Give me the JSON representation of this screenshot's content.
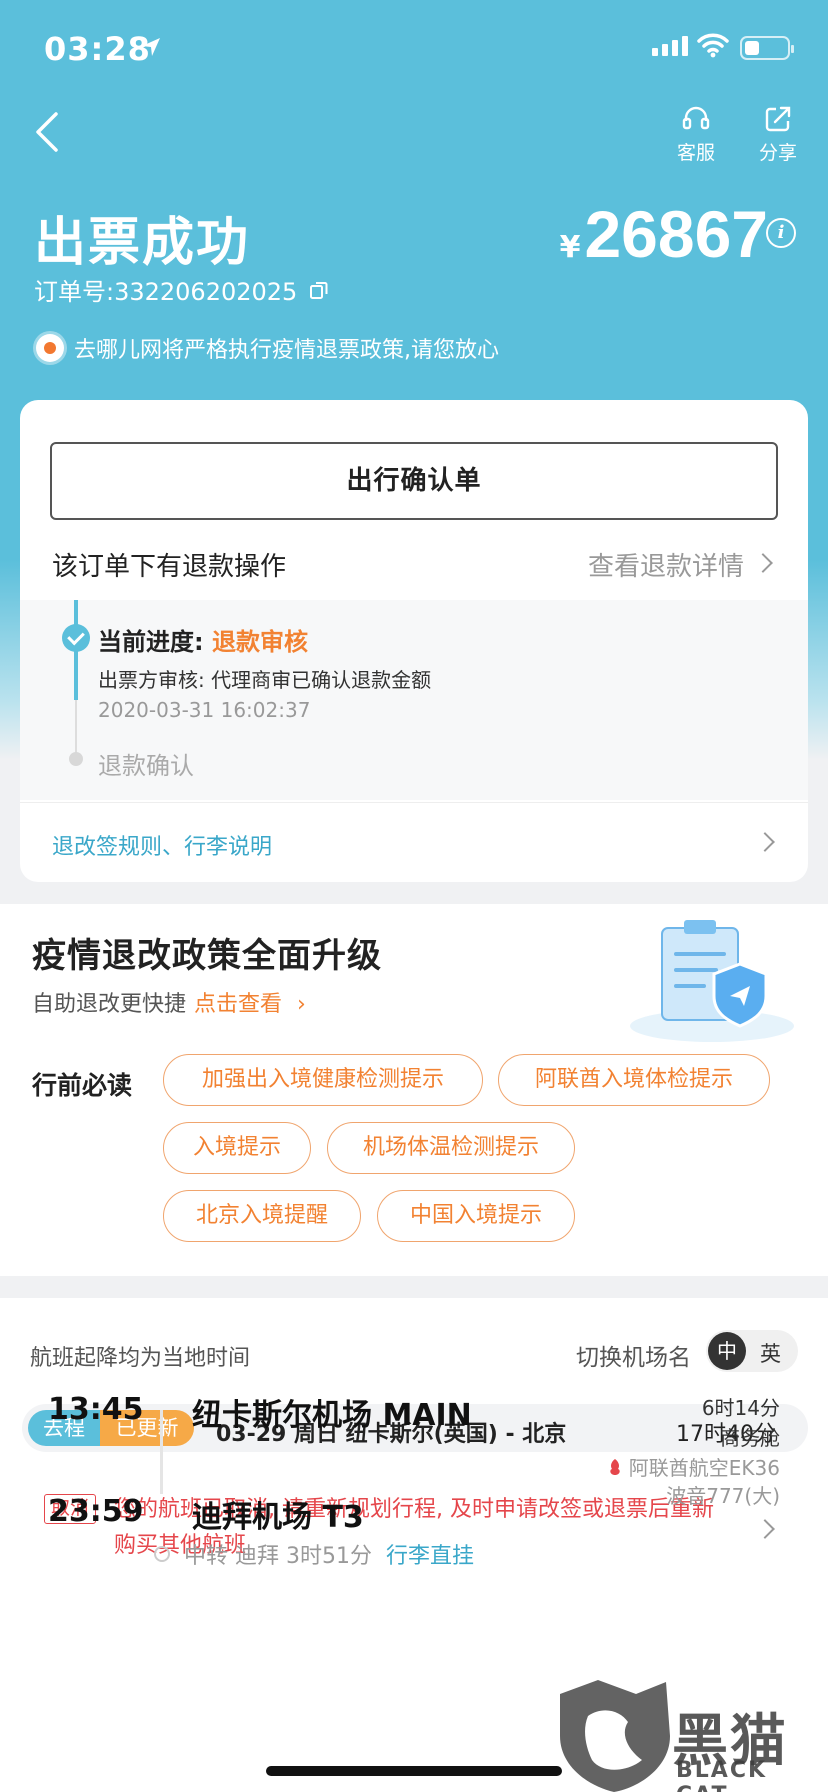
{
  "status_bar": {
    "time": "03:28"
  },
  "header": {
    "service_label": "客服",
    "share_label": "分享",
    "title": "出票成功",
    "currency": "¥",
    "price": "26867",
    "order_no": "订单号:332206202025",
    "notice": "去哪儿网将严格执行疫情退票政策,请您放心"
  },
  "card": {
    "confirm_button": "出行确认单",
    "refund_label": "该订单下有退款操作",
    "refund_link": "查看退款详情",
    "progress": {
      "current_label": "当前进度:",
      "current_state": "退款审核",
      "desc": "出票方审核: 代理商审已确认退款金额",
      "time": "2020-03-31 16:02:37",
      "next_step": "退款确认"
    },
    "rules_link": "退改签规则、行李说明"
  },
  "policy": {
    "title": "疫情退改政策全面升级",
    "subtitle": "自助退改更快捷",
    "subtitle_link": "点击查看",
    "must_read": "行前必读",
    "tags": [
      "加强出入境健康检测提示",
      "阿联酋入境体检提示",
      "入境提示",
      "机场体温检测提示",
      "北京入境提醒",
      "中国入境提示"
    ]
  },
  "flight": {
    "local_time_note": "航班起降均为当地时间",
    "switch_label": "切换机场名",
    "switch_on": "中",
    "switch_off": "英",
    "segment_type": "去程",
    "segment_status": "已更新",
    "route": "03-29  周日  纽卡斯尔(英国) - 北京",
    "duration": "17时40分",
    "cancel_tag": "取消",
    "cancel_text": "您的航班已取消, 请重新规划行程, 及时申请改签或退票后重新购买其他航班",
    "dep_time": "13:45",
    "dep_airport": "纽卡斯尔机场 MAIN",
    "arr_time": "23:59",
    "arr_airport": "迪拜机场 T3",
    "flight_duration": "6时14分",
    "cabin": "商务舱",
    "airline": "阿联酋航空EK36",
    "aircraft": "波音777(大)",
    "transit": "中转 迪拜 3时51分",
    "transit_link": "行李直挂"
  },
  "watermark": {
    "cn": "黑猫",
    "en": "BLACK CAT"
  },
  "colors": {
    "brand": "#5bbfdb",
    "accent": "#f28232",
    "danger": "#e5464b",
    "updated": "#f6a947"
  }
}
